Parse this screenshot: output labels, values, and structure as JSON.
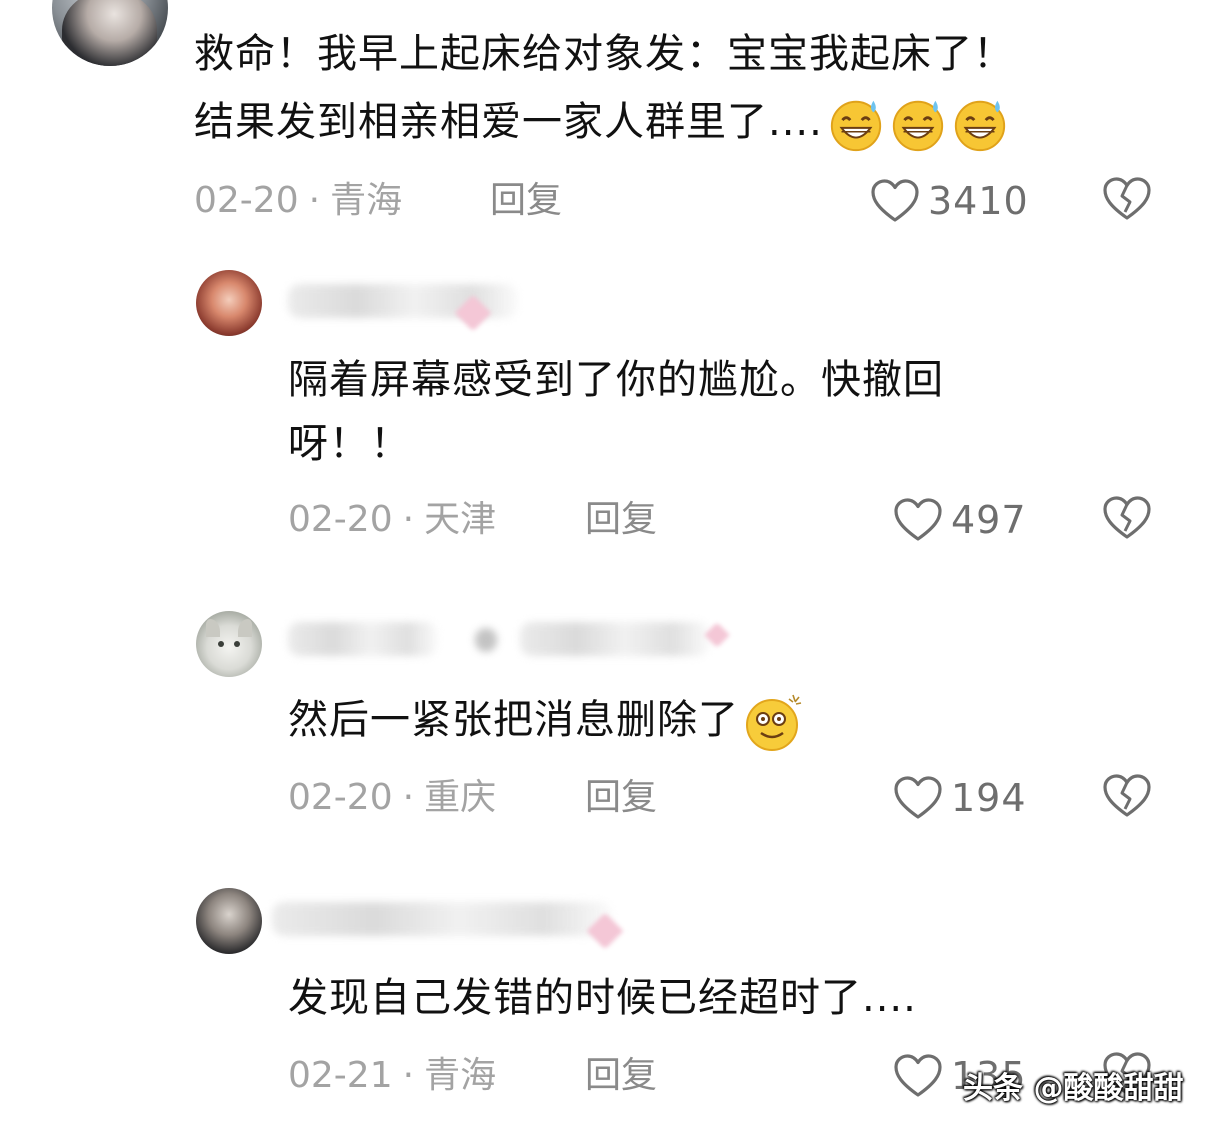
{
  "comments": [
    {
      "text_line1": "救命！我早上起床给对象发：宝宝我起床了！",
      "text_line2": "结果发到相亲相爱一家人群里了....",
      "date": "02-20",
      "location": "青海",
      "reply_label": "回复",
      "likes": "3410",
      "emoji": "grin-sweat-emoji"
    },
    {
      "text_line1": "隔着屏幕感受到了你的尴尬。快撤回",
      "text_line2": "呀！！",
      "date": "02-20",
      "location": "天津",
      "reply_label": "回复",
      "likes": "497"
    },
    {
      "text_line1": "然后一紧张把消息删除了",
      "date": "02-20",
      "location": "重庆",
      "reply_label": "回复",
      "likes": "194",
      "emoji": "dizzy-smile-emoji"
    },
    {
      "text_line1": "发现自己发错的时候已经超时了....",
      "date": "02-21",
      "location": "青海",
      "reply_label": "回复",
      "likes": "135"
    }
  ],
  "separator": "·",
  "watermark": "头条 @酸酸甜甜",
  "icons": {
    "like": "heart-outline-icon",
    "dislike": "broken-heart-icon"
  },
  "colors": {
    "text": "#111111",
    "meta": "#a3a3a3",
    "icon": "#6e6e6e"
  }
}
